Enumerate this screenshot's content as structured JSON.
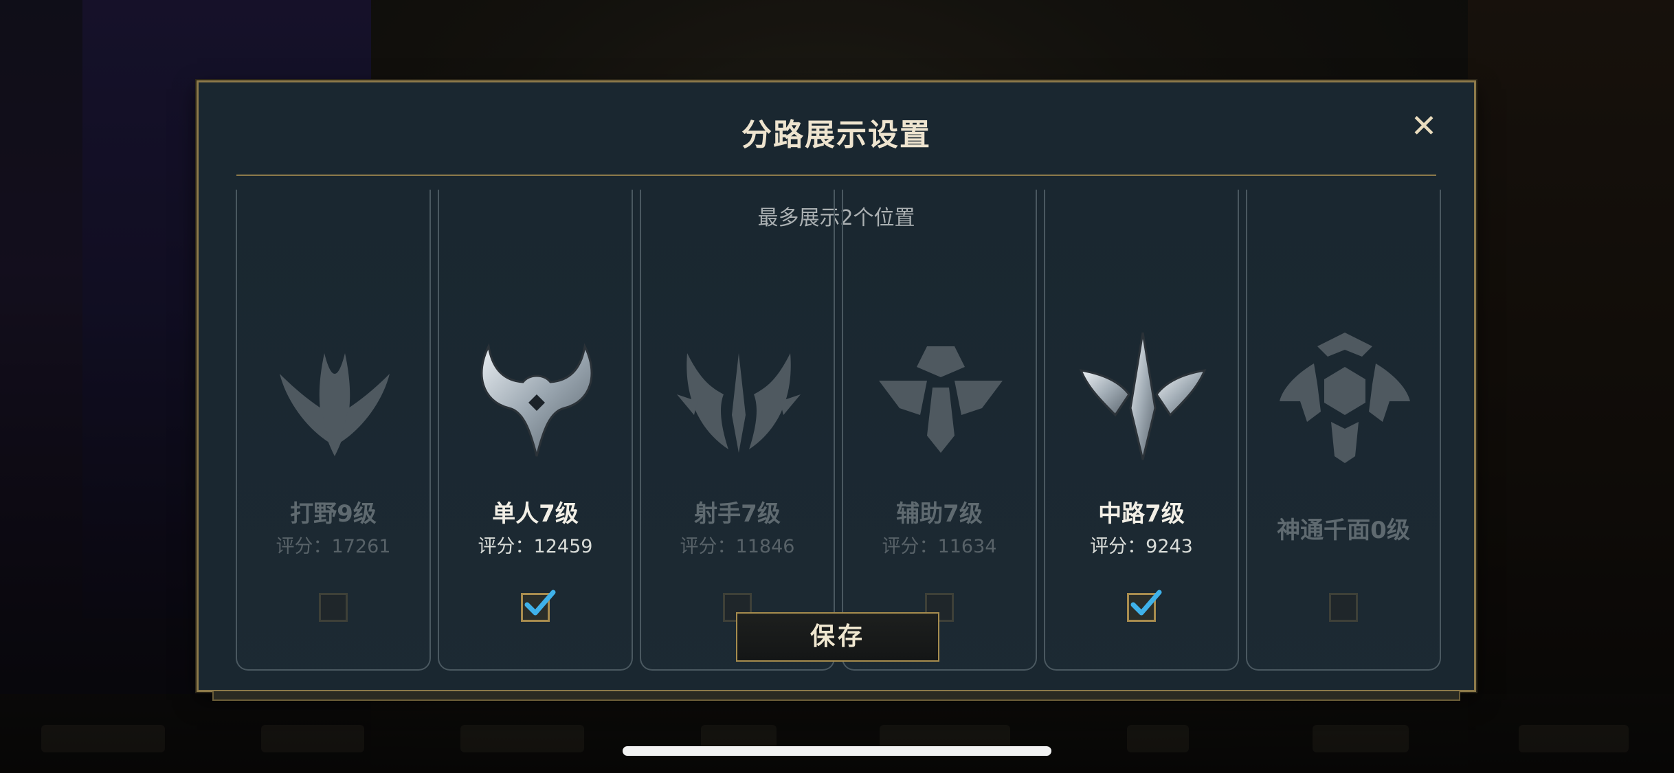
{
  "modal": {
    "title": "分路展示设置",
    "close_label": "✕",
    "subtitle": "最多展示2个位置",
    "save_label": "保存"
  },
  "lanes": [
    {
      "name": "打野9级",
      "score": "评分：17261",
      "checked": false,
      "icon": "jungle-emblem-icon"
    },
    {
      "name": "单人7级",
      "score": "评分：12459",
      "checked": true,
      "icon": "solo-lane-emblem-icon"
    },
    {
      "name": "射手7级",
      "score": "评分：11846",
      "checked": false,
      "icon": "marksman-emblem-icon"
    },
    {
      "name": "辅助7级",
      "score": "评分：11634",
      "checked": false,
      "icon": "support-emblem-icon"
    },
    {
      "name": "中路7级",
      "score": "评分：9243",
      "checked": true,
      "icon": "mid-lane-emblem-icon"
    },
    {
      "name": "神通千面0级",
      "score": "",
      "checked": false,
      "icon": "all-round-emblem-icon"
    }
  ],
  "colors": {
    "accent_gold": "#8d7a4a",
    "checkmark_blue": "#3fb2ea",
    "modal_bg": "#1a2730"
  }
}
